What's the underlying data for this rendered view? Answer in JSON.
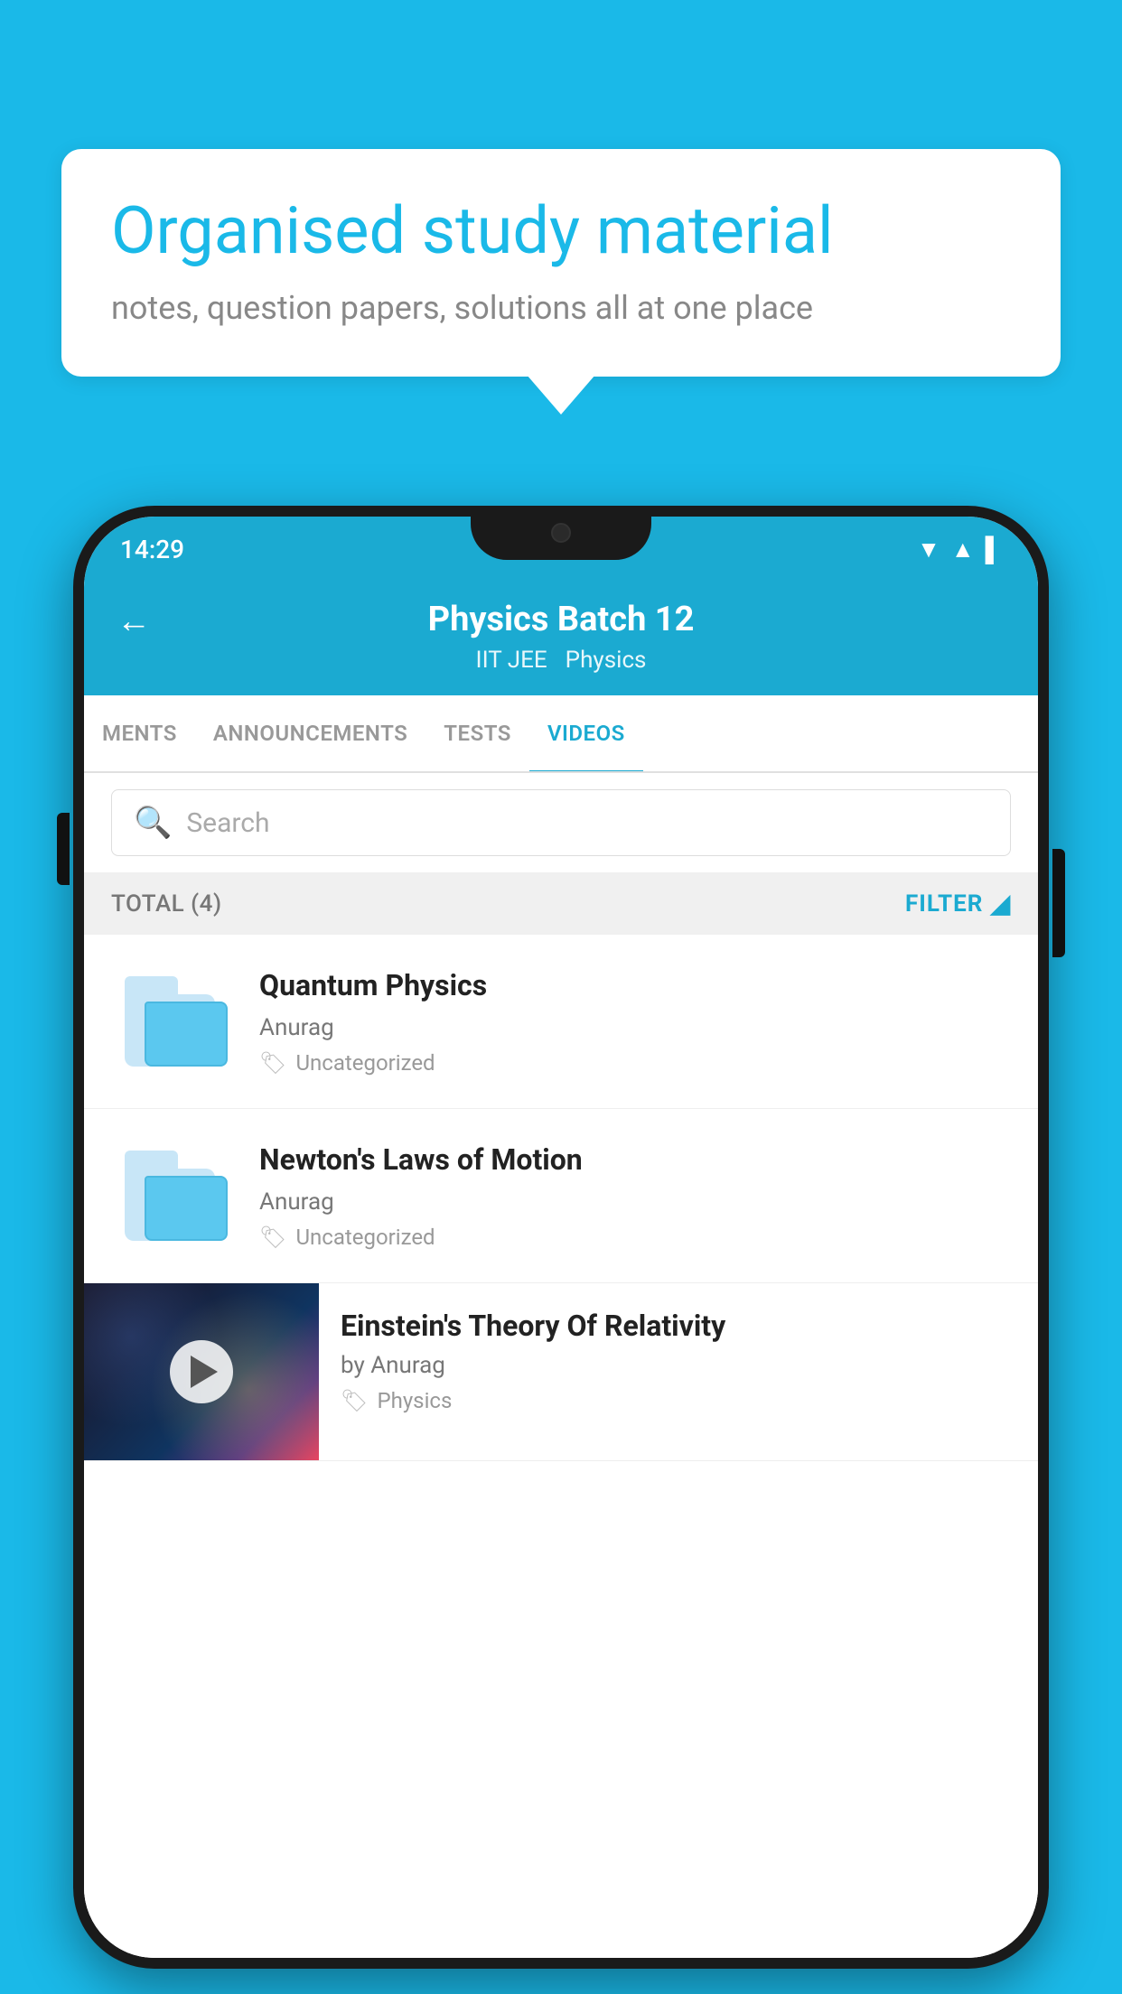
{
  "background_color": "#1ab9e8",
  "speech_bubble": {
    "title": "Organised study material",
    "subtitle": "notes, question papers, solutions all at one place"
  },
  "phone": {
    "status_bar": {
      "time": "14:29",
      "icons": [
        "wifi",
        "signal",
        "battery"
      ]
    },
    "header": {
      "back_label": "←",
      "title": "Physics Batch 12",
      "subtitle_left": "IIT JEE",
      "subtitle_right": "Physics"
    },
    "tabs": [
      {
        "label": "MENTS",
        "active": false
      },
      {
        "label": "ANNOUNCEMENTS",
        "active": false
      },
      {
        "label": "TESTS",
        "active": false
      },
      {
        "label": "VIDEOS",
        "active": true
      }
    ],
    "search": {
      "placeholder": "Search"
    },
    "filter_row": {
      "total_label": "TOTAL (4)",
      "filter_label": "FILTER"
    },
    "videos": [
      {
        "id": 1,
        "title": "Quantum Physics",
        "author": "Anurag",
        "tag": "Uncategorized",
        "has_thumbnail": false
      },
      {
        "id": 2,
        "title": "Newton's Laws of Motion",
        "author": "Anurag",
        "tag": "Uncategorized",
        "has_thumbnail": false
      },
      {
        "id": 3,
        "title": "Einstein's Theory Of Relativity",
        "author": "by Anurag",
        "tag": "Physics",
        "has_thumbnail": true
      }
    ]
  }
}
